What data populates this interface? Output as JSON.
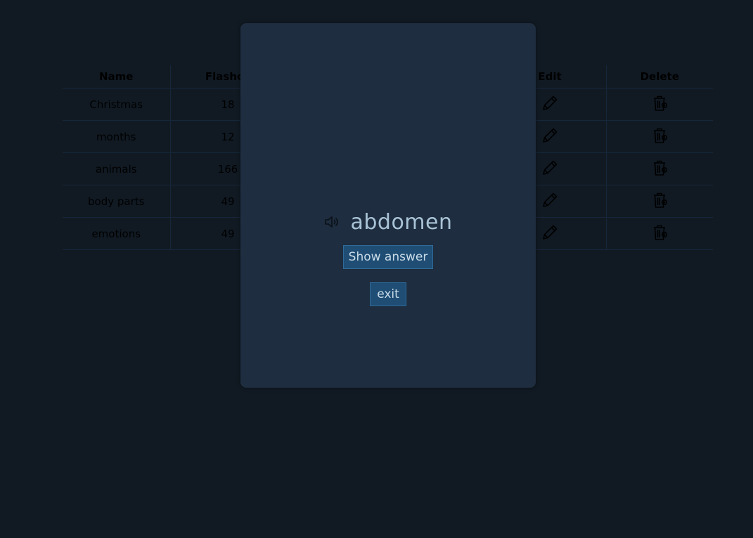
{
  "table": {
    "headers": {
      "name": "Name",
      "flashcards": "Flashca",
      "edit": "Edit",
      "delete": "Delete"
    },
    "rows": [
      {
        "name": "Christmas",
        "count": "18"
      },
      {
        "name": "months",
        "count": "12"
      },
      {
        "name": "animals",
        "count": "166"
      },
      {
        "name": "body parts",
        "count": "49"
      },
      {
        "name": "emotions",
        "count": "49"
      }
    ],
    "edit_icon": "pencil-icon",
    "delete_icon": "trash-icon"
  },
  "modal": {
    "word": "abdomen",
    "speaker_icon": "speaker-icon",
    "show_answer_label": "Show answer",
    "exit_label": "exit"
  },
  "colors": {
    "background": "#111a23",
    "modal": "#1e2d3f",
    "button": "#1f4d74",
    "word": "#a9c3d6"
  }
}
